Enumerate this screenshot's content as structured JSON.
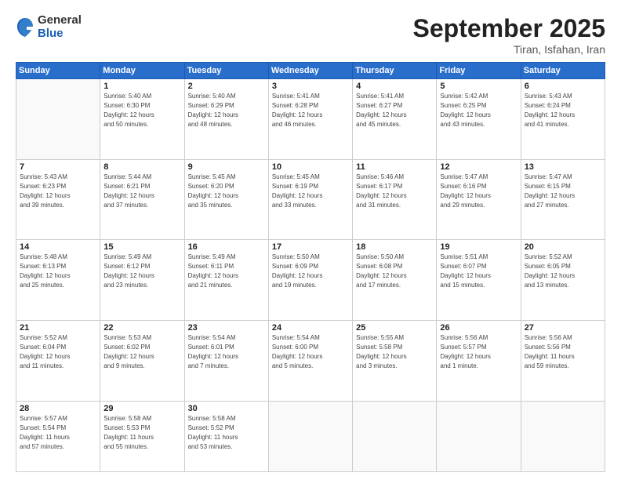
{
  "logo": {
    "general": "General",
    "blue": "Blue"
  },
  "header": {
    "month": "September 2025",
    "location": "Tiran, Isfahan, Iran"
  },
  "weekdays": [
    "Sunday",
    "Monday",
    "Tuesday",
    "Wednesday",
    "Thursday",
    "Friday",
    "Saturday"
  ],
  "weeks": [
    [
      {
        "day": "",
        "info": ""
      },
      {
        "day": "1",
        "info": "Sunrise: 5:40 AM\nSunset: 6:30 PM\nDaylight: 12 hours\nand 50 minutes."
      },
      {
        "day": "2",
        "info": "Sunrise: 5:40 AM\nSunset: 6:29 PM\nDaylight: 12 hours\nand 48 minutes."
      },
      {
        "day": "3",
        "info": "Sunrise: 5:41 AM\nSunset: 6:28 PM\nDaylight: 12 hours\nand 46 minutes."
      },
      {
        "day": "4",
        "info": "Sunrise: 5:41 AM\nSunset: 6:27 PM\nDaylight: 12 hours\nand 45 minutes."
      },
      {
        "day": "5",
        "info": "Sunrise: 5:42 AM\nSunset: 6:25 PM\nDaylight: 12 hours\nand 43 minutes."
      },
      {
        "day": "6",
        "info": "Sunrise: 5:43 AM\nSunset: 6:24 PM\nDaylight: 12 hours\nand 41 minutes."
      }
    ],
    [
      {
        "day": "7",
        "info": "Sunrise: 5:43 AM\nSunset: 6:23 PM\nDaylight: 12 hours\nand 39 minutes."
      },
      {
        "day": "8",
        "info": "Sunrise: 5:44 AM\nSunset: 6:21 PM\nDaylight: 12 hours\nand 37 minutes."
      },
      {
        "day": "9",
        "info": "Sunrise: 5:45 AM\nSunset: 6:20 PM\nDaylight: 12 hours\nand 35 minutes."
      },
      {
        "day": "10",
        "info": "Sunrise: 5:45 AM\nSunset: 6:19 PM\nDaylight: 12 hours\nand 33 minutes."
      },
      {
        "day": "11",
        "info": "Sunrise: 5:46 AM\nSunset: 6:17 PM\nDaylight: 12 hours\nand 31 minutes."
      },
      {
        "day": "12",
        "info": "Sunrise: 5:47 AM\nSunset: 6:16 PM\nDaylight: 12 hours\nand 29 minutes."
      },
      {
        "day": "13",
        "info": "Sunrise: 5:47 AM\nSunset: 6:15 PM\nDaylight: 12 hours\nand 27 minutes."
      }
    ],
    [
      {
        "day": "14",
        "info": "Sunrise: 5:48 AM\nSunset: 6:13 PM\nDaylight: 12 hours\nand 25 minutes."
      },
      {
        "day": "15",
        "info": "Sunrise: 5:49 AM\nSunset: 6:12 PM\nDaylight: 12 hours\nand 23 minutes."
      },
      {
        "day": "16",
        "info": "Sunrise: 5:49 AM\nSunset: 6:11 PM\nDaylight: 12 hours\nand 21 minutes."
      },
      {
        "day": "17",
        "info": "Sunrise: 5:50 AM\nSunset: 6:09 PM\nDaylight: 12 hours\nand 19 minutes."
      },
      {
        "day": "18",
        "info": "Sunrise: 5:50 AM\nSunset: 6:08 PM\nDaylight: 12 hours\nand 17 minutes."
      },
      {
        "day": "19",
        "info": "Sunrise: 5:51 AM\nSunset: 6:07 PM\nDaylight: 12 hours\nand 15 minutes."
      },
      {
        "day": "20",
        "info": "Sunrise: 5:52 AM\nSunset: 6:05 PM\nDaylight: 12 hours\nand 13 minutes."
      }
    ],
    [
      {
        "day": "21",
        "info": "Sunrise: 5:52 AM\nSunset: 6:04 PM\nDaylight: 12 hours\nand 11 minutes."
      },
      {
        "day": "22",
        "info": "Sunrise: 5:53 AM\nSunset: 6:02 PM\nDaylight: 12 hours\nand 9 minutes."
      },
      {
        "day": "23",
        "info": "Sunrise: 5:54 AM\nSunset: 6:01 PM\nDaylight: 12 hours\nand 7 minutes."
      },
      {
        "day": "24",
        "info": "Sunrise: 5:54 AM\nSunset: 6:00 PM\nDaylight: 12 hours\nand 5 minutes."
      },
      {
        "day": "25",
        "info": "Sunrise: 5:55 AM\nSunset: 5:58 PM\nDaylight: 12 hours\nand 3 minutes."
      },
      {
        "day": "26",
        "info": "Sunrise: 5:56 AM\nSunset: 5:57 PM\nDaylight: 12 hours\nand 1 minute."
      },
      {
        "day": "27",
        "info": "Sunrise: 5:56 AM\nSunset: 5:56 PM\nDaylight: 11 hours\nand 59 minutes."
      }
    ],
    [
      {
        "day": "28",
        "info": "Sunrise: 5:57 AM\nSunset: 5:54 PM\nDaylight: 11 hours\nand 57 minutes."
      },
      {
        "day": "29",
        "info": "Sunrise: 5:58 AM\nSunset: 5:53 PM\nDaylight: 11 hours\nand 55 minutes."
      },
      {
        "day": "30",
        "info": "Sunrise: 5:58 AM\nSunset: 5:52 PM\nDaylight: 11 hours\nand 53 minutes."
      },
      {
        "day": "",
        "info": ""
      },
      {
        "day": "",
        "info": ""
      },
      {
        "day": "",
        "info": ""
      },
      {
        "day": "",
        "info": ""
      }
    ]
  ]
}
